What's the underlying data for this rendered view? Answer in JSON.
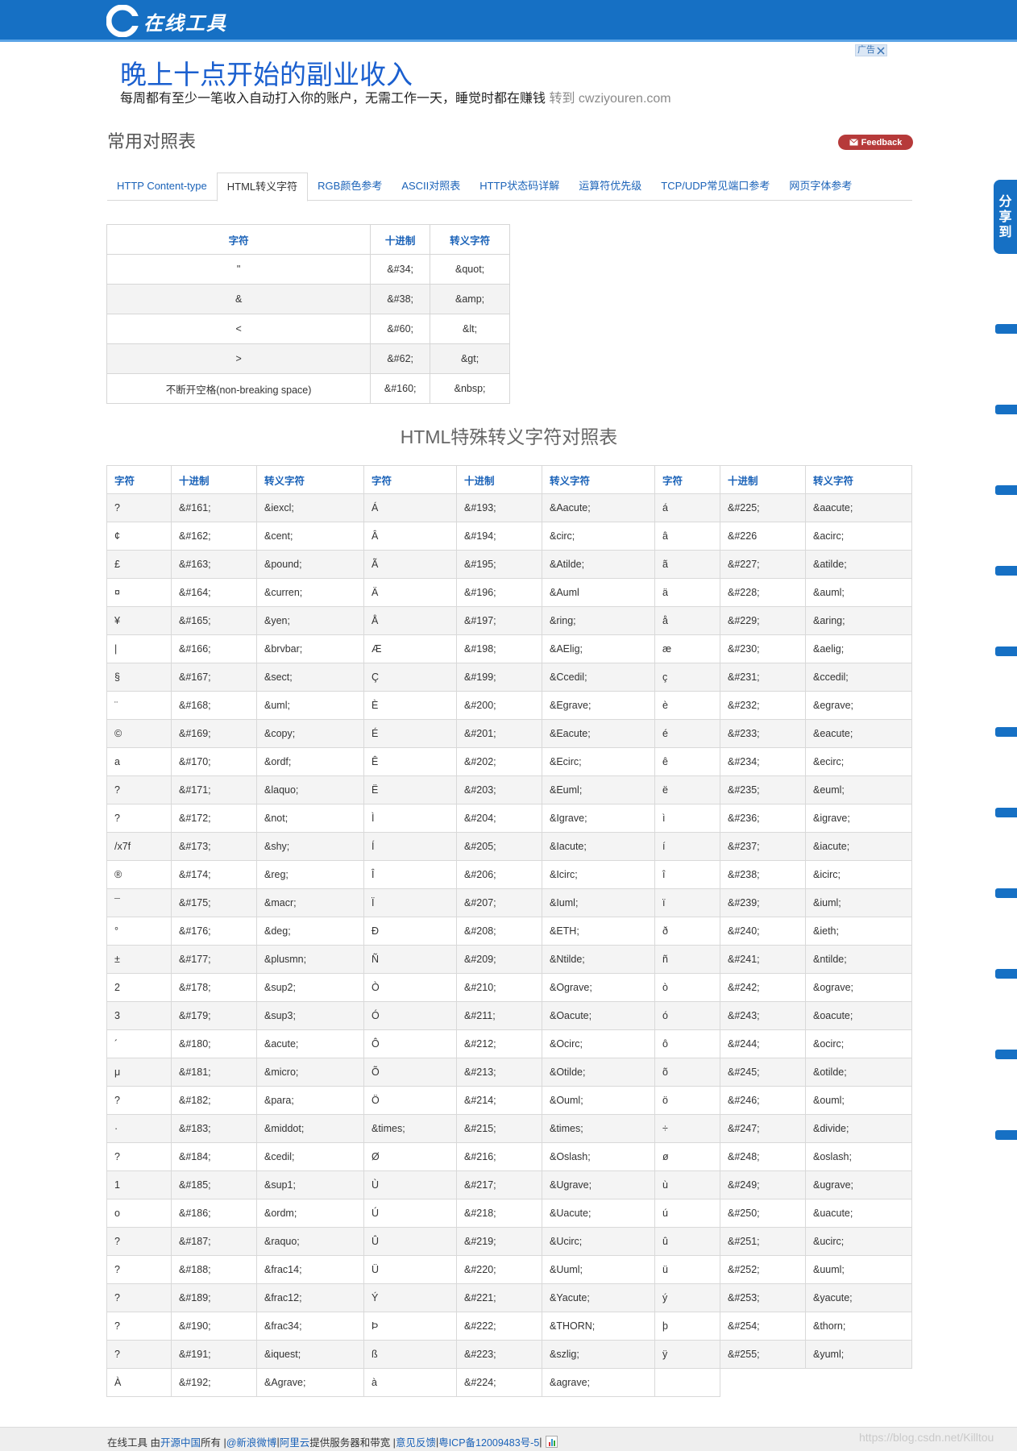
{
  "header": {
    "logo_text": "在线工具"
  },
  "ad": {
    "tag": "广告",
    "title": "晚上十点开始的副业收入",
    "desc": "每周都有至少一笔收入自动打入你的账户，无需工作一天，睡觉时都在赚钱",
    "link_text": "转到 cwziyouren.com"
  },
  "page": {
    "title": "常用对照表",
    "feedback_label": "Feedback"
  },
  "tabs": [
    {
      "label": "HTTP Content-type",
      "active": false
    },
    {
      "label": "HTML转义字符",
      "active": true
    },
    {
      "label": "RGB颜色参考",
      "active": false
    },
    {
      "label": "ASCII对照表",
      "active": false
    },
    {
      "label": "HTTP状态码详解",
      "active": false
    },
    {
      "label": "运算符优先级",
      "active": false
    },
    {
      "label": "TCP/UDP常见端口参考",
      "active": false
    },
    {
      "label": "网页字体参考",
      "active": false
    }
  ],
  "table1": {
    "headers": [
      "字符",
      "十进制",
      "转义字符"
    ],
    "rows": [
      [
        "\"",
        "&#34;",
        "&quot;"
      ],
      [
        "&",
        "&#38;",
        "&amp;"
      ],
      [
        "<",
        "&#60;",
        "&lt;"
      ],
      [
        ">",
        "&#62;",
        "&gt;"
      ],
      [
        "不断开空格(non-breaking space)",
        "&#160;",
        "&nbsp;"
      ]
    ]
  },
  "section_title": "HTML特殊转义字符对照表",
  "table2": {
    "headers": [
      "字符",
      "十进制",
      "转义字符",
      "字符",
      "十进制",
      "转义字符",
      "字符",
      "十进制",
      "转义字符"
    ],
    "rows": [
      [
        "?",
        "&#161;",
        "&iexcl;",
        "Á",
        "&#193;",
        "&Aacute;",
        "á",
        "&#225;",
        "&aacute;"
      ],
      [
        "¢",
        "&#162;",
        "&cent;",
        "Â",
        "&#194;",
        "&circ;",
        "â",
        "&#226",
        "&acirc;"
      ],
      [
        "£",
        "&#163;",
        "&pound;",
        "Ã",
        "&#195;",
        "&Atilde;",
        "ã",
        "&#227;",
        "&atilde;"
      ],
      [
        "¤",
        "&#164;",
        "&curren;",
        "Ä",
        "&#196;",
        "&Auml",
        "ä",
        "&#228;",
        "&auml;"
      ],
      [
        "¥",
        "&#165;",
        "&yen;",
        "Å",
        "&#197;",
        "&ring;",
        "å",
        "&#229;",
        "&aring;"
      ],
      [
        "|",
        "&#166;",
        "&brvbar;",
        "Æ",
        "&#198;",
        "&AElig;",
        "æ",
        "&#230;",
        "&aelig;"
      ],
      [
        "§",
        "&#167;",
        "&sect;",
        "Ç",
        "&#199;",
        "&Ccedil;",
        "ç",
        "&#231;",
        "&ccedil;"
      ],
      [
        "¨",
        "&#168;",
        "&uml;",
        "È",
        "&#200;",
        "&Egrave;",
        "è",
        "&#232;",
        "&egrave;"
      ],
      [
        "©",
        "&#169;",
        "&copy;",
        "É",
        "&#201;",
        "&Eacute;",
        "é",
        "&#233;",
        "&eacute;"
      ],
      [
        "a",
        "&#170;",
        "&ordf;",
        "Ê",
        "&#202;",
        "&Ecirc;",
        "ê",
        "&#234;",
        "&ecirc;"
      ],
      [
        "?",
        "&#171;",
        "&laquo;",
        "Ë",
        "&#203;",
        "&Euml;",
        "ë",
        "&#235;",
        "&euml;"
      ],
      [
        "?",
        "&#172;",
        "&not;",
        "Ì",
        "&#204;",
        "&Igrave;",
        "ì",
        "&#236;",
        "&igrave;"
      ],
      [
        "/x7f",
        "&#173;",
        "&shy;",
        "Í",
        "&#205;",
        "&Iacute;",
        "í",
        "&#237;",
        "&iacute;"
      ],
      [
        "®",
        "&#174;",
        "&reg;",
        "Î",
        "&#206;",
        "&Icirc;",
        "î",
        "&#238;",
        "&icirc;"
      ],
      [
        "¯",
        "&#175;",
        "&macr;",
        "Ï",
        "&#207;",
        "&Iuml;",
        "ï",
        "&#239;",
        "&iuml;"
      ],
      [
        "°",
        "&#176;",
        "&deg;",
        "Ð",
        "&#208;",
        "&ETH;",
        "ð",
        "&#240;",
        "&ieth;"
      ],
      [
        "±",
        "&#177;",
        "&plusmn;",
        "Ñ",
        "&#209;",
        "&Ntilde;",
        "ñ",
        "&#241;",
        "&ntilde;"
      ],
      [
        "2",
        "&#178;",
        "&sup2;",
        "Ò",
        "&#210;",
        "&Ograve;",
        "ò",
        "&#242;",
        "&ograve;"
      ],
      [
        "3",
        "&#179;",
        "&sup3;",
        "Ó",
        "&#211;",
        "&Oacute;",
        "ó",
        "&#243;",
        "&oacute;"
      ],
      [
        "´",
        "&#180;",
        "&acute;",
        "Ô",
        "&#212;",
        "&Ocirc;",
        "ô",
        "&#244;",
        "&ocirc;"
      ],
      [
        "μ",
        "&#181;",
        "&micro;",
        "Õ",
        "&#213;",
        "&Otilde;",
        "õ",
        "&#245;",
        "&otilde;"
      ],
      [
        "?",
        "&#182;",
        "&para;",
        "Ö",
        "&#214;",
        "&Ouml;",
        "ö",
        "&#246;",
        "&ouml;"
      ],
      [
        "·",
        "&#183;",
        "&middot;",
        "&times;",
        "&#215;",
        "&times;",
        "÷",
        "&#247;",
        "&divide;"
      ],
      [
        "?",
        "&#184;",
        "&cedil;",
        "Ø",
        "&#216;",
        "&Oslash;",
        "ø",
        "&#248;",
        "&oslash;"
      ],
      [
        "1",
        "&#185;",
        "&sup1;",
        "Ù",
        "&#217;",
        "&Ugrave;",
        "ù",
        "&#249;",
        "&ugrave;"
      ],
      [
        "o",
        "&#186;",
        "&ordm;",
        "Ú",
        "&#218;",
        "&Uacute;",
        "ú",
        "&#250;",
        "&uacute;"
      ],
      [
        "?",
        "&#187;",
        "&raquo;",
        "Û",
        "&#219;",
        "&Ucirc;",
        "û",
        "&#251;",
        "&ucirc;"
      ],
      [
        "?",
        "&#188;",
        "&frac14;",
        "Ü",
        "&#220;",
        "&Uuml;",
        "ü",
        "&#252;",
        "&uuml;"
      ],
      [
        "?",
        "&#189;",
        "&frac12;",
        "Ý",
        "&#221;",
        "&Yacute;",
        "ý",
        "&#253;",
        "&yacute;"
      ],
      [
        "?",
        "&#190;",
        "&frac34;",
        "Þ",
        "&#222;",
        "&THORN;",
        "þ",
        "&#254;",
        "&thorn;"
      ],
      [
        "?",
        "&#191;",
        "&iquest;",
        "ß",
        "&#223;",
        "&szlig;",
        "ÿ",
        "&#255;",
        "&yuml;"
      ],
      [
        "À",
        "&#192;",
        "&Agrave;",
        "à",
        "&#224;",
        "&agrave;",
        "",
        null,
        null
      ]
    ]
  },
  "share": {
    "chars": [
      "分",
      "享",
      "到"
    ]
  },
  "footer": {
    "prefix": "在线工具 由 ",
    "kaiyuan": "开源中国",
    "all": " 所有 | ",
    "weibo": "@新浪微博",
    "sep1": " |",
    "aliyun": "阿里云",
    "service": "提供服务器和带宽 |",
    "feedback": "意见反馈",
    "sep2": " | ",
    "icp": "粤ICP备12009483号-5",
    "sep3": " | "
  },
  "watermark": "https://blog.csdn.net/Killtou",
  "colors": {
    "brand_blue": "#1670c4",
    "link_blue": "#1a62b8",
    "feedback_red": "#b63a3a"
  }
}
